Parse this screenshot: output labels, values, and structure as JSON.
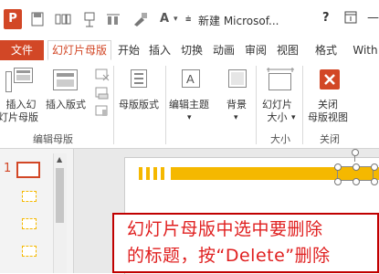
{
  "app": {
    "logo_text": "P",
    "title": "新建 Microsof...",
    "help": "?"
  },
  "qat": {
    "font_label": "A"
  },
  "tabs": [
    "文件",
    "幻灯片母版",
    "开始",
    "插入",
    "切换",
    "动画",
    "审阅",
    "视图",
    "格式",
    "With"
  ],
  "ribbon": {
    "insert_slide_master": "插入幻\n灯片母版",
    "insert_slide_master_l1": "插入幻",
    "insert_slide_master_l2": "灯片母版",
    "insert_layout": "插入版式",
    "master_layout": "母版版式",
    "edit_theme": "编辑主题",
    "background": "背景",
    "slide_size_l1": "幻灯片",
    "slide_size_l2": "大小",
    "close_master_l1": "关闭",
    "close_master_l2": "母版视图",
    "group_edit_master": "编辑母版",
    "group_size": "大小",
    "group_close": "关闭"
  },
  "thumbnails": {
    "first_number": "1"
  },
  "caption": {
    "line1": "幻灯片母版中选中要删除",
    "line2": "的标题，按“Delete”删除"
  },
  "colors": {
    "accent": "#d24726",
    "title_bar": "#f5b800",
    "caption_red": "#e02020"
  }
}
